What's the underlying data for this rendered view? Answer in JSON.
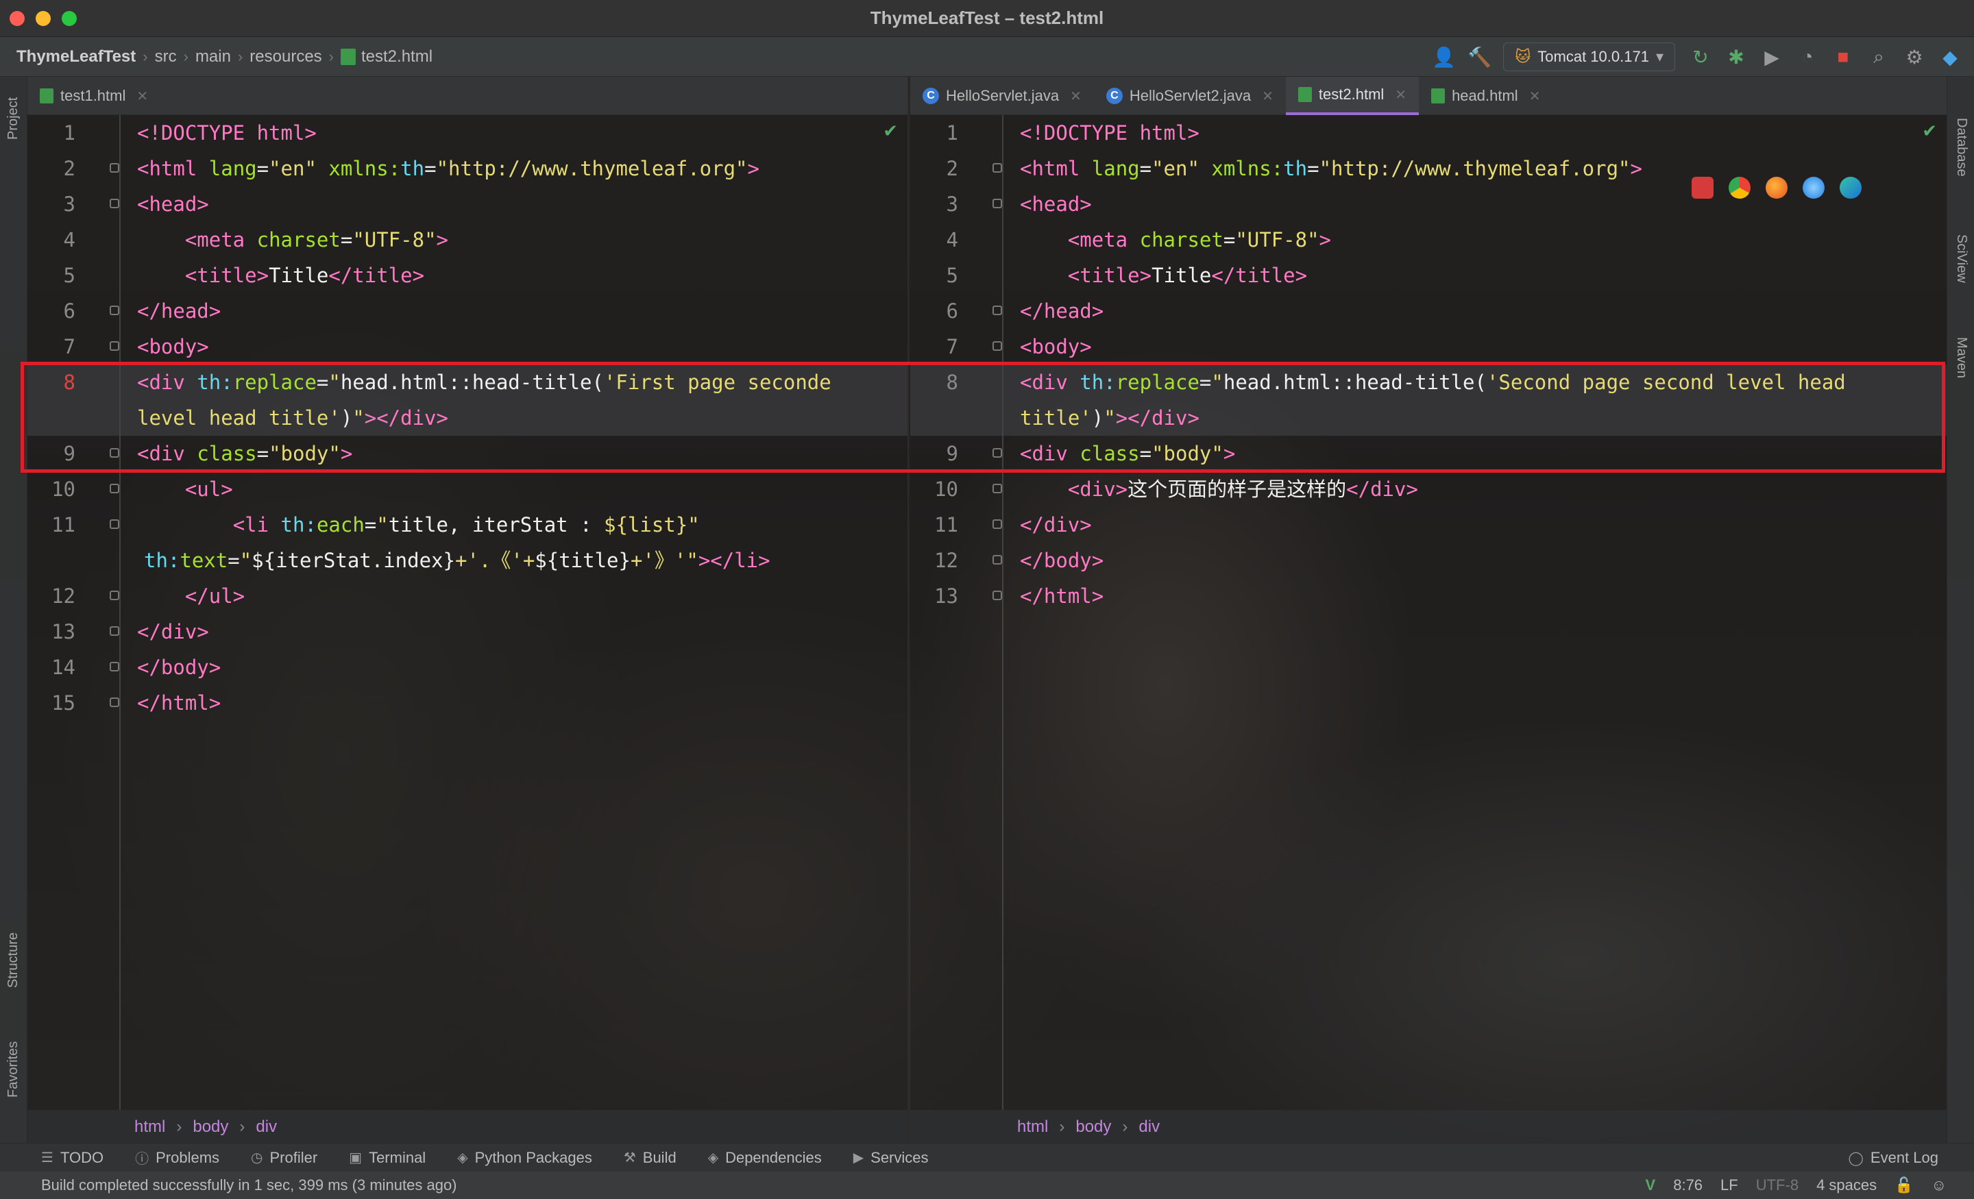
{
  "window": {
    "title": "ThymeLeafTest – test2.html"
  },
  "navbar": {
    "breadcrumb": [
      "ThymeLeafTest",
      "src",
      "main",
      "resources",
      "test2.html"
    ],
    "run_config": "Tomcat 10.0.171"
  },
  "left_strip": {
    "top_label": "Project",
    "bottom_labels": [
      "Structure",
      "Favorites"
    ]
  },
  "right_strip": {
    "labels": [
      "Database",
      "SciView",
      "Maven"
    ]
  },
  "left_pane": {
    "tabs": [
      {
        "label": "test1.html",
        "type": "html",
        "active": false
      }
    ],
    "lines": [
      {
        "num": "1",
        "html": "<span class='pink'>&lt;!DOCTYPE html&gt;</span>"
      },
      {
        "num": "2",
        "html": "<span class='pink'>&lt;html</span> <span class='attr'>lang</span>=<span class='str'>\"en\"</span> <span class='attr'>xmlns:</span><span class='kw'>th</span>=<span class='str'>\"http://www.thymeleaf.org\"</span><span class='pink'>&gt;</span>"
      },
      {
        "num": "3",
        "html": "<span class='pink'>&lt;head&gt;</span>"
      },
      {
        "num": "4",
        "html": "    <span class='pink'>&lt;meta</span> <span class='attr'>charset</span>=<span class='str'>\"UTF-8\"</span><span class='pink'>&gt;</span>"
      },
      {
        "num": "5",
        "html": "    <span class='pink'>&lt;title&gt;</span><span class='plain'>Title</span><span class='pink'>&lt;/title&gt;</span>"
      },
      {
        "num": "6",
        "html": "<span class='pink'>&lt;/head&gt;</span>"
      },
      {
        "num": "7",
        "html": "<span class='pink'>&lt;body&gt;</span>"
      },
      {
        "num": "8",
        "html": "<span class='pink'>&lt;div</span> <span class='kw'>th:</span><span class='attr'>replace</span>=<span class='str'>\"</span><span class='plain'>head.html::head-title(</span><span class='str'>'First page seconde</span>",
        "highlight": true,
        "num_red": true
      },
      {
        "num": "",
        "html": "<span class='str'>level head title'</span><span class='plain'>)</span><span class='str'>\"</span><span class='pink'>&gt;&lt;/div&gt;</span>",
        "highlight": true,
        "cont": true
      },
      {
        "num": "9",
        "html": "<span class='pink'>&lt;div</span> <span class='attr'>class</span>=<span class='str'>\"body\"</span><span class='pink'>&gt;</span>"
      },
      {
        "num": "10",
        "html": "    <span class='pink'>&lt;ul&gt;</span>"
      },
      {
        "num": "11",
        "html": "        <span class='pink'>&lt;li</span> <span class='kw'>th:</span><span class='attr'>each</span>=<span class='str'>\"</span><span class='plain'>title, iterStat : </span><span class='str'>${list}\"</span>"
      },
      {
        "num": "",
        "html": "<span class='kw'>th:</span><span class='attr'>text</span>=<span class='str'>\"</span><span class='plain'>${iterStat.index}</span><span class='str'>+'.《'+</span><span class='plain'>${title}</span><span class='str'>+'》'\"</span><span class='pink'>&gt;&lt;/li&gt;</span>",
        "cont": true
      },
      {
        "num": "12",
        "html": "    <span class='pink'>&lt;/ul&gt;</span>"
      },
      {
        "num": "13",
        "html": "<span class='pink'>&lt;/div&gt;</span>"
      },
      {
        "num": "14",
        "html": "<span class='pink'>&lt;/body&gt;</span>"
      },
      {
        "num": "15",
        "html": "<span class='pink'>&lt;/html&gt;</span>"
      }
    ],
    "breadcrumb": [
      "html",
      "body",
      "div"
    ]
  },
  "right_pane": {
    "tabs": [
      {
        "label": "HelloServlet.java",
        "type": "class",
        "active": false
      },
      {
        "label": "HelloServlet2.java",
        "type": "class",
        "active": false
      },
      {
        "label": "test2.html",
        "type": "html",
        "active": true
      },
      {
        "label": "head.html",
        "type": "html",
        "active": false
      }
    ],
    "lines": [
      {
        "num": "1",
        "html": "<span class='pink'>&lt;!DOCTYPE html&gt;</span>"
      },
      {
        "num": "2",
        "html": "<span class='pink'>&lt;html</span> <span class='attr'>lang</span>=<span class='str'>\"en\"</span> <span class='attr'>xmlns:</span><span class='kw'>th</span>=<span class='str'>\"http://www.thymeleaf.org\"</span><span class='pink'>&gt;</span>"
      },
      {
        "num": "3",
        "html": "<span class='pink'>&lt;head&gt;</span>"
      },
      {
        "num": "4",
        "html": "    <span class='pink'>&lt;meta</span> <span class='attr'>charset</span>=<span class='str'>\"UTF-8\"</span><span class='pink'>&gt;</span>"
      },
      {
        "num": "5",
        "html": "    <span class='pink'>&lt;title&gt;</span><span class='plain'>Title</span><span class='pink'>&lt;/title&gt;</span>"
      },
      {
        "num": "6",
        "html": "<span class='pink'>&lt;/head&gt;</span>"
      },
      {
        "num": "7",
        "html": "<span class='pink'>&lt;body&gt;</span>"
      },
      {
        "num": "8",
        "html": "<span class='pink'>&lt;div</span> <span class='kw'>th:</span><span class='attr'>replace</span>=<span class='str'>\"</span><span class='plain'>head.html::head-title(</span><span class='str'>'Second page second level head</span>",
        "highlight": true,
        "num_red": false
      },
      {
        "num": "",
        "html": "<span class='str'>title'</span><span class='plain'>)</span><span class='str'>\"</span><span class='pink'>&gt;&lt;/div&gt;</span>",
        "highlight": true,
        "cont": true
      },
      {
        "num": "9",
        "html": "<span class='pink'>&lt;div</span> <span class='attr'>class</span>=<span class='str'>\"body\"</span><span class='pink'>&gt;</span>"
      },
      {
        "num": "10",
        "html": "    <span class='pink'>&lt;div&gt;</span><span class='plain'>这个页面的样子是这样的</span><span class='pink'>&lt;/div&gt;</span>"
      },
      {
        "num": "11",
        "html": "<span class='pink'>&lt;/div&gt;</span>"
      },
      {
        "num": "12",
        "html": "<span class='pink'>&lt;/body&gt;</span>"
      },
      {
        "num": "13",
        "html": "<span class='pink'>&lt;/html&gt;</span>"
      }
    ],
    "breadcrumb": [
      "html",
      "body",
      "div"
    ]
  },
  "bottom_tools": [
    "TODO",
    "Problems",
    "Profiler",
    "Terminal",
    "Python Packages",
    "Build",
    "Dependencies",
    "Services"
  ],
  "event_log": "Event Log",
  "status": {
    "message": "Build completed successfully in 1 sec, 399 ms (3 minutes ago)",
    "position": "8:76",
    "line_sep": "LF",
    "encoding": "UTF-8",
    "indent": "4 spaces"
  }
}
